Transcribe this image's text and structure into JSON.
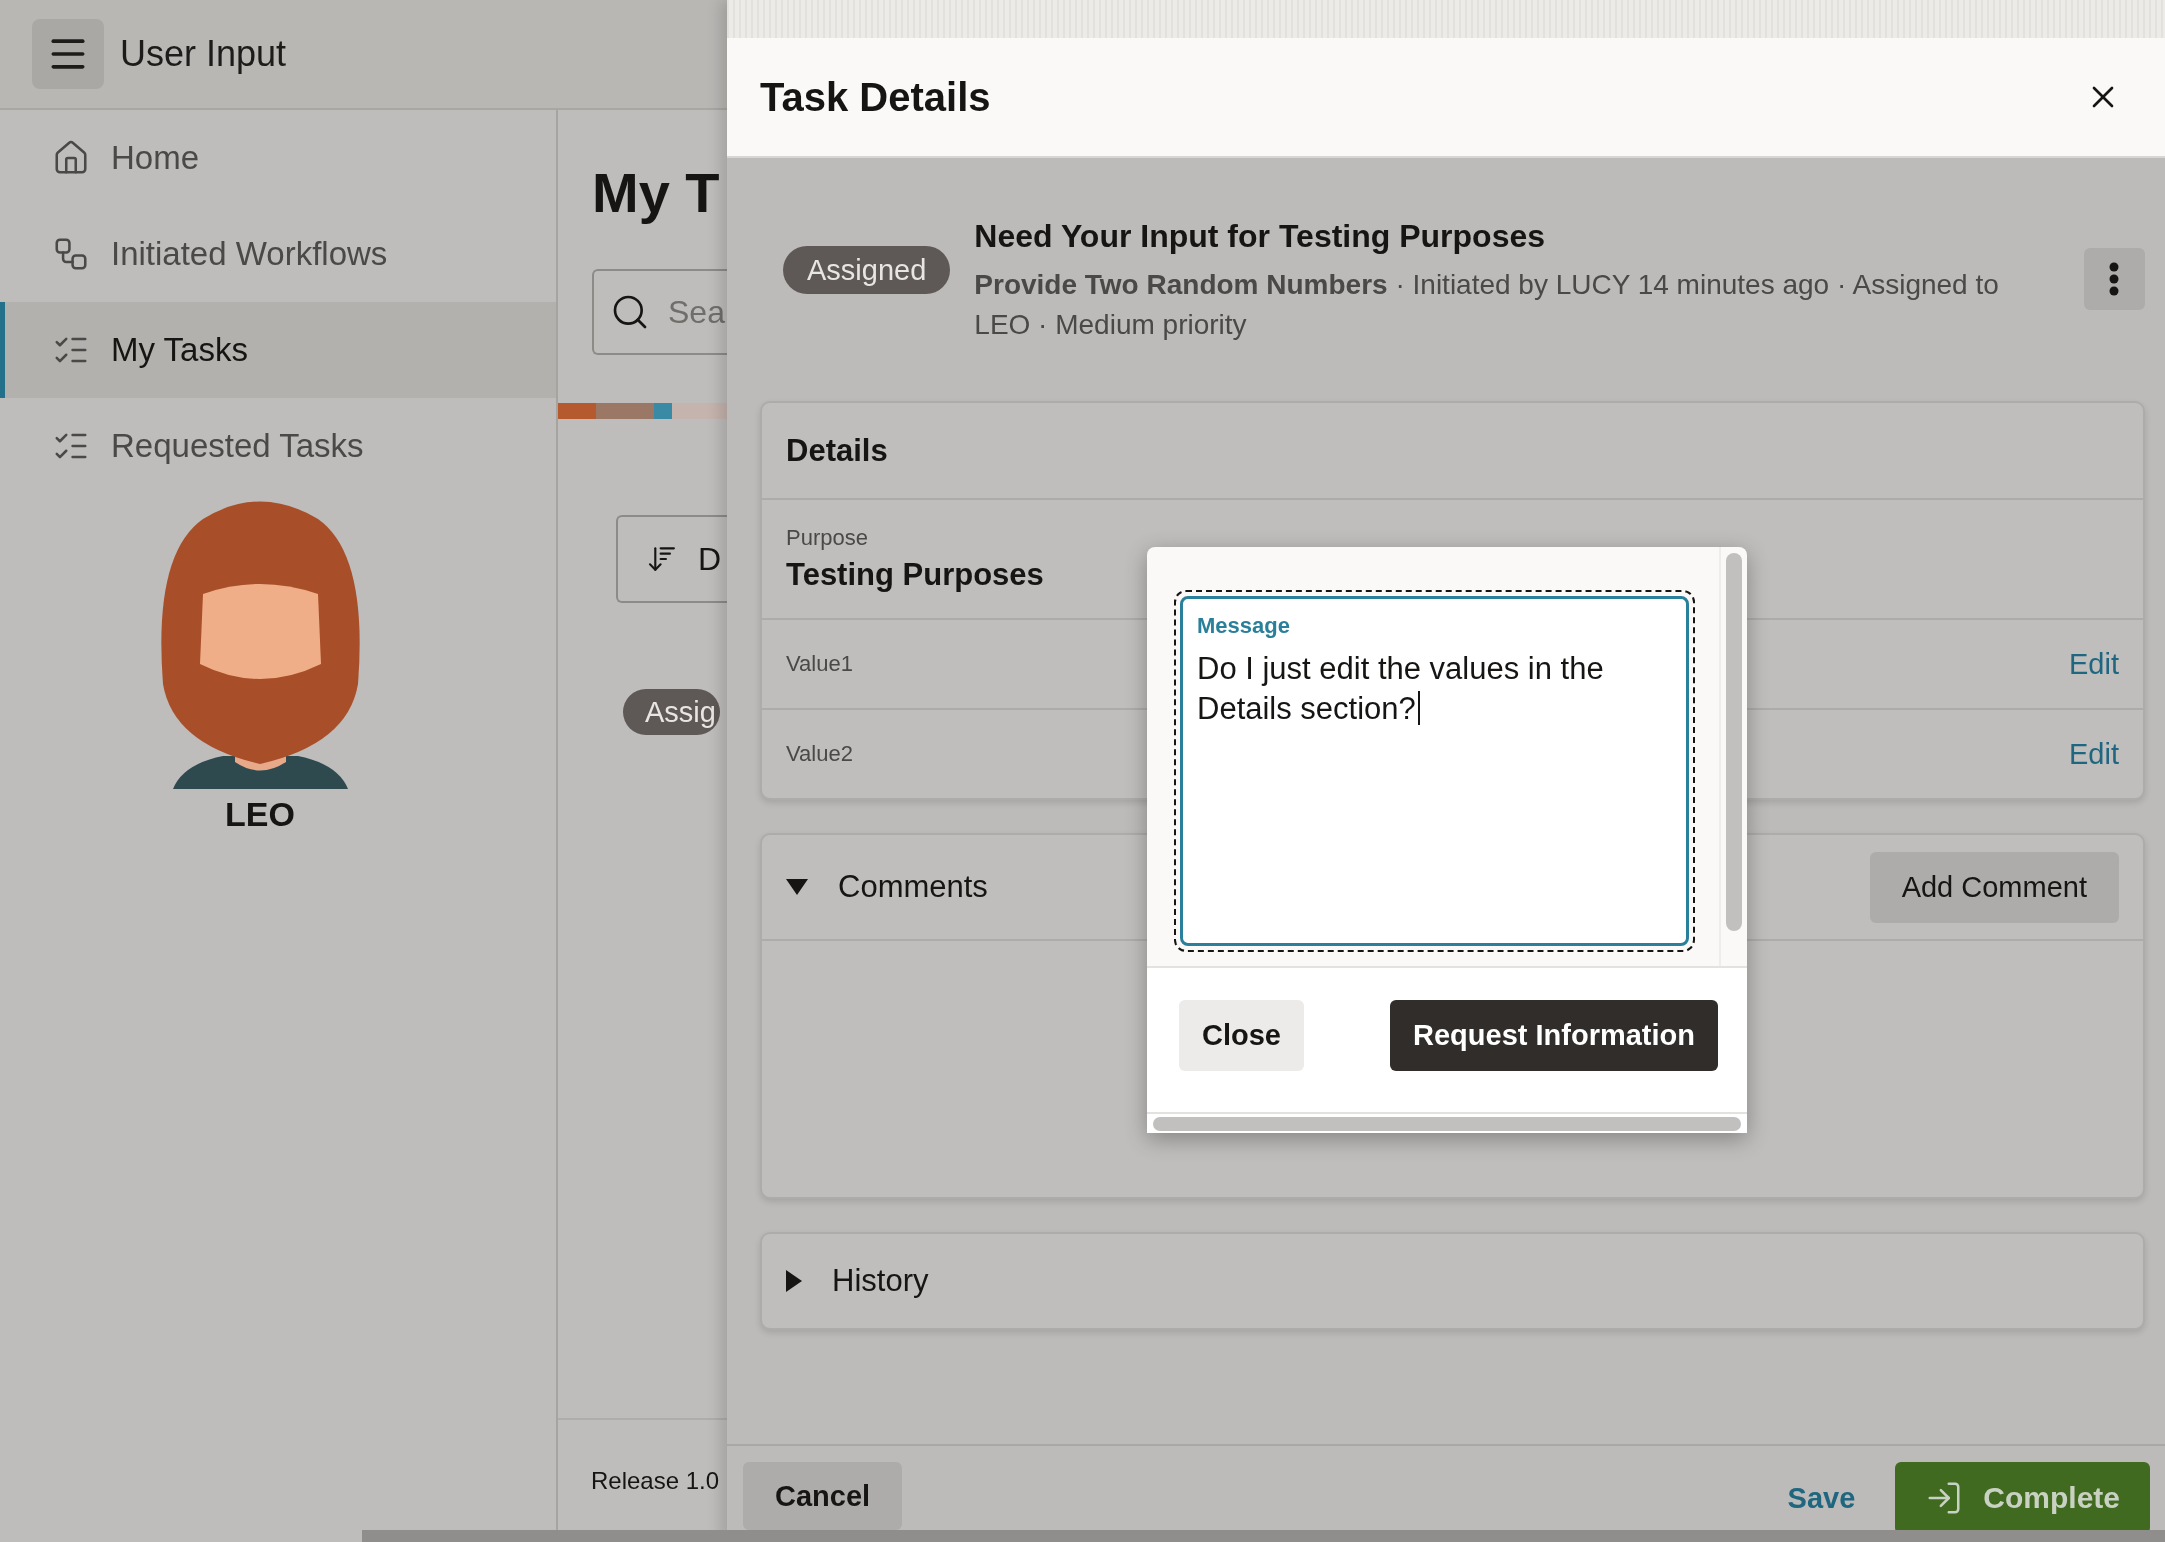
{
  "app": {
    "title": "User Input"
  },
  "nav": [
    {
      "label": "Home",
      "selected": false
    },
    {
      "label": "Initiated Workflows",
      "selected": false
    },
    {
      "label": "My Tasks",
      "selected": true
    },
    {
      "label": "Requested Tasks",
      "selected": false
    }
  ],
  "user": {
    "name": "LEO"
  },
  "page": {
    "heading": "My T",
    "search_placeholder": "Sea",
    "sort_label": "D",
    "badge": "Assig",
    "release": "Release 1.0"
  },
  "drawer": {
    "title": "Task Details",
    "task": {
      "status": "Assigned",
      "title": "Need Your Input for Testing Purposes",
      "subtitle": "**Provide Two Random Numbers** · Initiated by LUCY 14 minutes ago · Assigned to LEO · Medium priority"
    },
    "details": {
      "title": "Details",
      "fields": [
        {
          "label": "Purpose",
          "value": "Testing Purposes"
        },
        {
          "label": "Value1",
          "action": "Edit"
        },
        {
          "label": "Value2",
          "action": "Edit"
        }
      ]
    },
    "sections": [
      {
        "title": "Comments",
        "expanded": true,
        "action": "Add Comment"
      },
      {
        "title": "History",
        "expanded": false
      }
    ],
    "footer": {
      "cancel": "Cancel",
      "save": "Save",
      "complete": "Complete"
    }
  },
  "dialog": {
    "field_label": "Message",
    "value": "Do I just edit the values in the Details section?",
    "buttons": [
      {
        "label": "Close",
        "kind": "secondary"
      },
      {
        "label": "Request Information",
        "kind": "primary"
      }
    ]
  }
}
